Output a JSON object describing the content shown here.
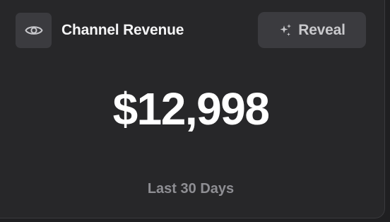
{
  "card": {
    "title": "Channel Revenue",
    "reveal_label": "Reveal",
    "amount": "$12,998",
    "period": "Last 30 Days",
    "icons": {
      "visibility": "eye-icon",
      "reveal": "sparkles-icon"
    }
  },
  "colors": {
    "card_background": "#272729",
    "button_background": "#3b3b3f",
    "amount_text": "#ffffff",
    "muted_text": "#8e8e93"
  }
}
